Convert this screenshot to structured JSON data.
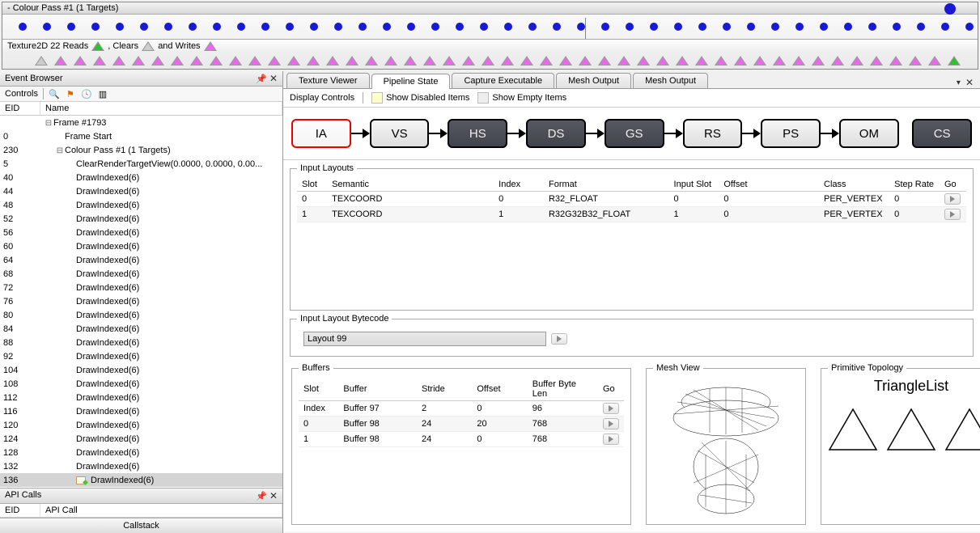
{
  "top": {
    "pass_title": "- Colour Pass #1 (1 Targets)",
    "sub_text_prefix": "Texture2D 22 Reads ",
    "sub_text_mid1": ", Clears ",
    "sub_text_mid2": " and Writes "
  },
  "event_browser": {
    "title": "Event Browser",
    "controls_label": "Controls",
    "col_eid": "EID",
    "col_name": "Name",
    "api_calls_title": "API Calls",
    "api_header_eid": "EID",
    "api_header_call": "API Call",
    "callstack_label": "Callstack",
    "rows": [
      {
        "eid": "",
        "name": "Frame #1793",
        "depth": 0,
        "expand": "⊟"
      },
      {
        "eid": "0",
        "name": "Frame Start",
        "depth": 1
      },
      {
        "eid": "230",
        "name": "Colour Pass #1 (1 Targets)",
        "depth": 1,
        "expand": "⊟"
      },
      {
        "eid": "5",
        "name": "ClearRenderTargetView(0.0000, 0.0000, 0.00...",
        "depth": 2
      },
      {
        "eid": "40",
        "name": "DrawIndexed(6)",
        "depth": 2
      },
      {
        "eid": "44",
        "name": "DrawIndexed(6)",
        "depth": 2
      },
      {
        "eid": "48",
        "name": "DrawIndexed(6)",
        "depth": 2
      },
      {
        "eid": "52",
        "name": "DrawIndexed(6)",
        "depth": 2
      },
      {
        "eid": "56",
        "name": "DrawIndexed(6)",
        "depth": 2
      },
      {
        "eid": "60",
        "name": "DrawIndexed(6)",
        "depth": 2
      },
      {
        "eid": "64",
        "name": "DrawIndexed(6)",
        "depth": 2
      },
      {
        "eid": "68",
        "name": "DrawIndexed(6)",
        "depth": 2
      },
      {
        "eid": "72",
        "name": "DrawIndexed(6)",
        "depth": 2
      },
      {
        "eid": "76",
        "name": "DrawIndexed(6)",
        "depth": 2
      },
      {
        "eid": "80",
        "name": "DrawIndexed(6)",
        "depth": 2
      },
      {
        "eid": "84",
        "name": "DrawIndexed(6)",
        "depth": 2
      },
      {
        "eid": "88",
        "name": "DrawIndexed(6)",
        "depth": 2
      },
      {
        "eid": "92",
        "name": "DrawIndexed(6)",
        "depth": 2
      },
      {
        "eid": "104",
        "name": "DrawIndexed(6)",
        "depth": 2
      },
      {
        "eid": "108",
        "name": "DrawIndexed(6)",
        "depth": 2
      },
      {
        "eid": "112",
        "name": "DrawIndexed(6)",
        "depth": 2
      },
      {
        "eid": "116",
        "name": "DrawIndexed(6)",
        "depth": 2
      },
      {
        "eid": "120",
        "name": "DrawIndexed(6)",
        "depth": 2
      },
      {
        "eid": "124",
        "name": "DrawIndexed(6)",
        "depth": 2
      },
      {
        "eid": "128",
        "name": "DrawIndexed(6)",
        "depth": 2
      },
      {
        "eid": "132",
        "name": "DrawIndexed(6)",
        "depth": 2
      },
      {
        "eid": "136",
        "name": "DrawIndexed(6)",
        "depth": 2,
        "selected": true,
        "icon": true
      }
    ]
  },
  "tabs": {
    "items": [
      "Texture Viewer",
      "Pipeline State",
      "Capture Executable",
      "Mesh Output",
      "Mesh Output"
    ],
    "active_index": 1
  },
  "display_controls": {
    "label": "Display Controls",
    "show_disabled": "Show Disabled Items",
    "show_empty": "Show Empty Items"
  },
  "pipeline": {
    "stages": [
      {
        "code": "IA",
        "sel": true
      },
      {
        "code": "VS"
      },
      {
        "code": "HS",
        "dark": true
      },
      {
        "code": "DS",
        "dark": true
      },
      {
        "code": "GS",
        "dark": true
      },
      {
        "code": "RS"
      },
      {
        "code": "PS"
      },
      {
        "code": "OM"
      },
      {
        "code": "CS",
        "dark": true,
        "gap": true
      }
    ]
  },
  "input_layouts": {
    "title": "Input Layouts",
    "cols": [
      "Slot",
      "Semantic",
      "Index",
      "Format",
      "Input Slot",
      "Offset",
      "Class",
      "Step Rate",
      "Go"
    ],
    "rows": [
      [
        "0",
        "TEXCOORD",
        "0",
        "R32_FLOAT",
        "0",
        "0",
        "PER_VERTEX",
        "0"
      ],
      [
        "1",
        "TEXCOORD",
        "1",
        "R32G32B32_FLOAT",
        "1",
        "0",
        "PER_VERTEX",
        "0"
      ]
    ]
  },
  "bytecode": {
    "title": "Input Layout Bytecode",
    "value": "Layout 99"
  },
  "buffers": {
    "title": "Buffers",
    "cols": [
      "Slot",
      "Buffer",
      "Stride",
      "Offset",
      "Buffer Byte Len",
      "Go"
    ],
    "rows": [
      [
        "Index",
        "Buffer 97",
        "2",
        "0",
        "96"
      ],
      [
        "0",
        "Buffer 98",
        "24",
        "20",
        "768"
      ],
      [
        "1",
        "Buffer 98",
        "24",
        "0",
        "768"
      ]
    ]
  },
  "mesh_view": {
    "title": "Mesh View"
  },
  "primitive_topology": {
    "title": "Primitive Topology",
    "value": "TriangleList"
  }
}
